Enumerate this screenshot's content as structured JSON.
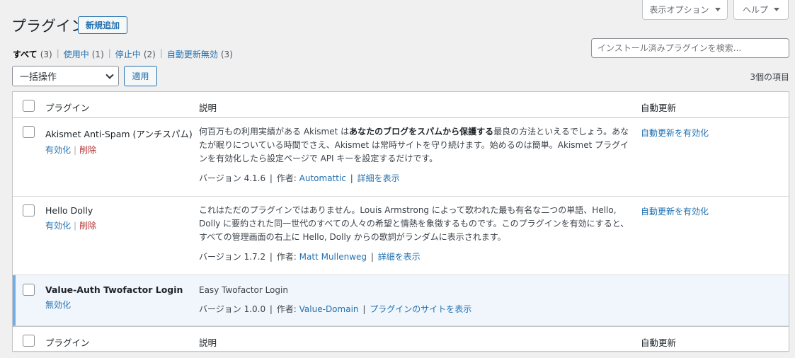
{
  "screen_options": {
    "label": "表示オプション"
  },
  "help": {
    "label": "ヘルプ"
  },
  "page_title": "プラグイン",
  "add_new_label": "新規追加",
  "filters": [
    {
      "label": "すべて",
      "count": "(3)"
    },
    {
      "label": "使用中",
      "count": "(1)"
    },
    {
      "label": "停止中",
      "count": "(2)"
    },
    {
      "label": "自動更新無効",
      "count": "(3)"
    }
  ],
  "search": {
    "placeholder": "インストール済みプラグインを検索..."
  },
  "bulk_actions": {
    "selected": "一括操作",
    "apply_label": "適用"
  },
  "item_count": "3個の項目",
  "table": {
    "headers": {
      "plugin": "プラグイン",
      "description": "説明",
      "auto_update": "自動更新"
    },
    "rows": [
      {
        "name": "Akismet Anti-Spam (アンチスパム)",
        "actions": [
          "有効化",
          "削除"
        ],
        "desc_pre": "何百万もの利用実績がある Akismet は",
        "desc_bold": "あなたのブログをスパムから保護する",
        "desc_post": "最良の方法といえるでしょう。あなたが眠りについている時間でさえ、Akismet は常時サイトを守り続けます。始めるのは簡単。Akismet プラグインを有効化したら設定ページで API キーを設定するだけです。",
        "version": "バージョン 4.1.6",
        "author_label": "作者:",
        "author": "Automattic",
        "detail_link": "詳細を表示",
        "auto_update": "自動更新を有効化"
      },
      {
        "name": "Hello Dolly",
        "actions": [
          "有効化",
          "削除"
        ],
        "desc": "これはただのプラグインではありません。Louis Armstrong によって歌われた最も有名な二つの単語、Hello, Dolly に要約された同一世代のすべての人々の希望と情熱を象徴するものです。このプラグインを有効にすると、すべての管理画面の右上に Hello, Dolly からの歌詞がランダムに表示されます。",
        "version": "バージョン 1.7.2",
        "author_label": "作者:",
        "author": "Matt Mullenweg",
        "detail_link": "詳細を表示",
        "auto_update": "自動更新を有効化"
      },
      {
        "name": "Value-Auth Twofactor Login",
        "actions": [
          "無効化"
        ],
        "desc": "Easy Twofactor Login",
        "version": "バージョン 1.0.0",
        "author_label": "作者:",
        "author": "Value-Domain",
        "detail_link": "プラグインのサイトを表示"
      }
    ]
  },
  "colors": {
    "link": "#2271b1",
    "delete": "#b32d2e",
    "active_row_bg": "#f0f6fc",
    "active_row_border": "#72aee6"
  }
}
